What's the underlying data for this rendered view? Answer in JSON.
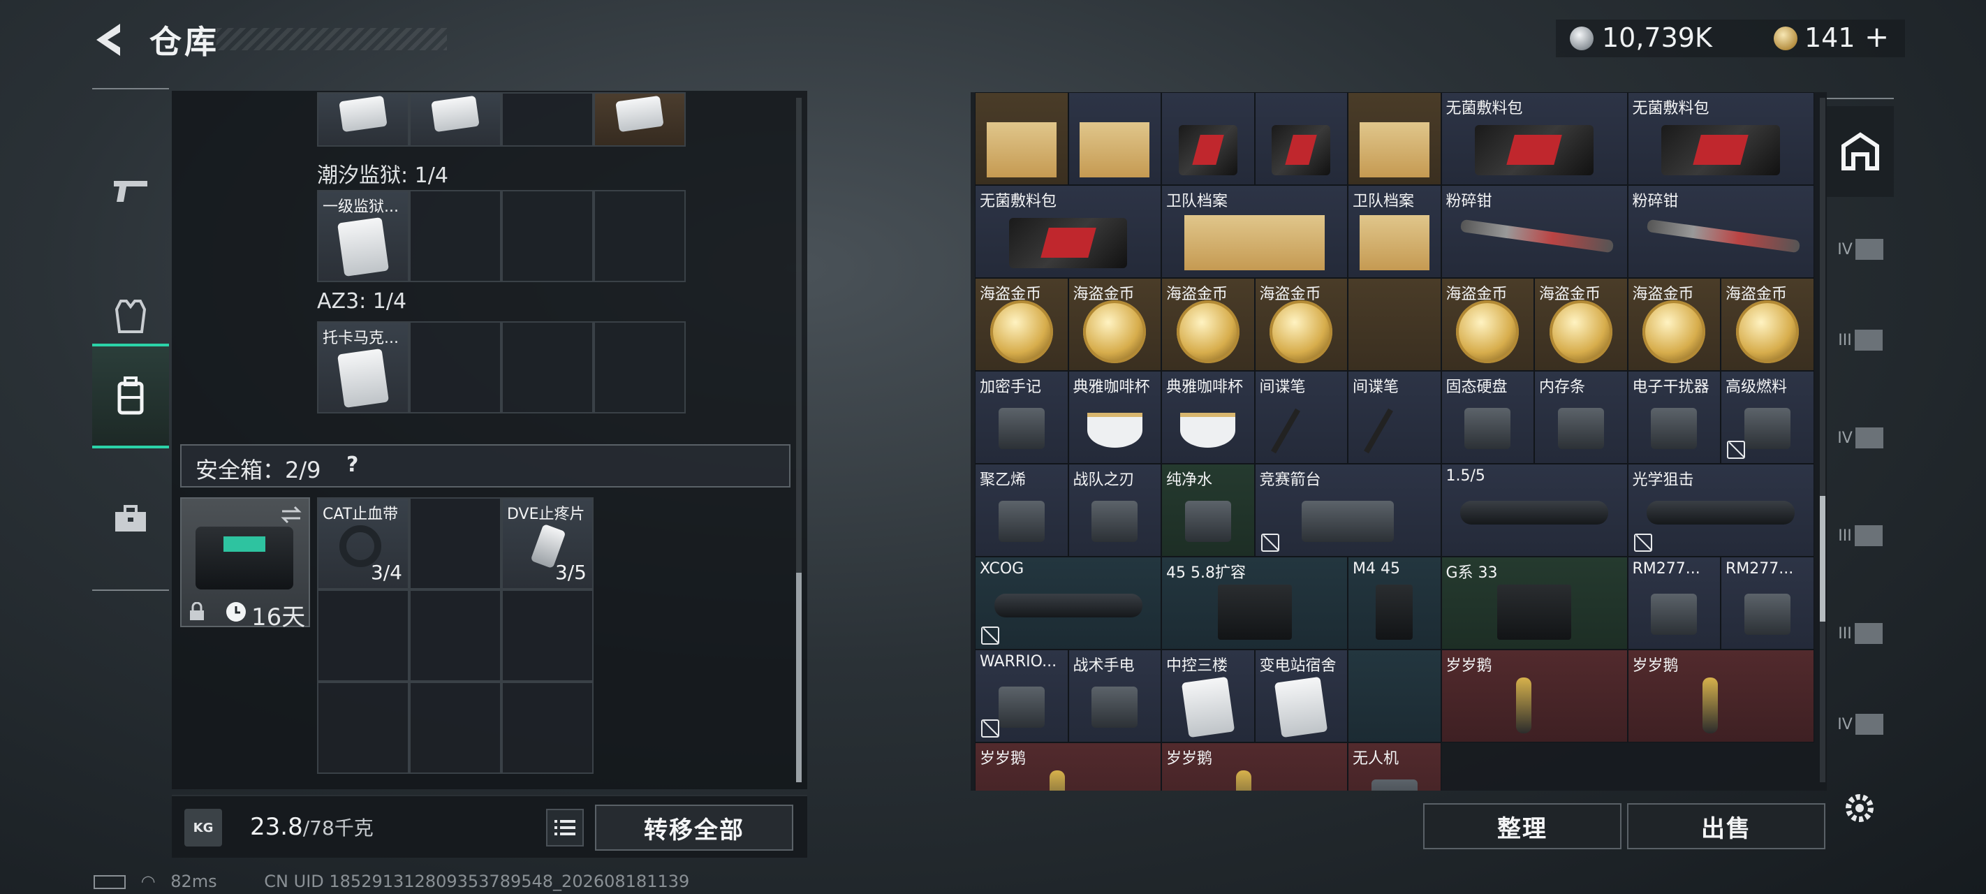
{
  "header": {
    "title": "仓库",
    "currency": {
      "silver": "10,739K",
      "gold": "141"
    },
    "add_label": "+"
  },
  "left_rail": [
    "rifle-tab",
    "armor-tab",
    "backpack-tab",
    "case-tab"
  ],
  "storage": {
    "sections": [
      {
        "label": "潮汐监狱: 1/4",
        "items": [
          {
            "name": "一级监狱..."
          }
        ]
      },
      {
        "label": "AZ3: 1/4",
        "items": [
          {
            "name": "托卡马克..."
          }
        ]
      }
    ],
    "safebox": {
      "label": "安全箱：2/9",
      "help": "?",
      "duration": "16天",
      "items": [
        {
          "name": "CAT止血带",
          "count": "3/4"
        },
        {
          "name": "DVE止疼片",
          "count": "3/5"
        }
      ]
    },
    "weight": {
      "current": "23.8",
      "unit": "/78千克"
    },
    "kg_label": "KG",
    "transfer_all": "转移全部"
  },
  "inventory": {
    "rows": [
      [
        {
          "name": "",
          "bg": "gold",
          "art": "file"
        },
        {
          "name": "",
          "bg": "blue",
          "art": "file"
        },
        {
          "name": "",
          "bg": "blue",
          "art": "pack"
        },
        {
          "name": "",
          "bg": "blue",
          "art": "pack"
        },
        {
          "name": "",
          "bg": "gold",
          "art": "file"
        }
      ],
      [
        {
          "name": "无菌敷料包",
          "bg": "blue",
          "art": "pack",
          "span": 2
        },
        {
          "name": "无菌敷料包",
          "bg": "blue",
          "art": "pack",
          "span": 2
        },
        {
          "name": "无菌敷料包",
          "bg": "blue",
          "art": "pack",
          "span": 2
        },
        {
          "name": "卫队档案",
          "bg": "blue",
          "art": "file",
          "span": 2
        },
        {
          "name": "卫队档案",
          "bg": "blue",
          "art": "file",
          "span": 1
        }
      ],
      [
        {
          "name": "粉碎钳",
          "bg": "blue",
          "art": "pliers",
          "span": 2
        },
        {
          "name": "粉碎钳",
          "bg": "blue",
          "art": "pliers",
          "span": 2
        },
        {
          "name": "海盗金币",
          "bg": "gold",
          "art": "coin"
        },
        {
          "name": "海盗金币",
          "bg": "gold",
          "art": "coin"
        },
        {
          "name": "海盗金币",
          "bg": "gold",
          "art": "coin"
        },
        {
          "name": "海盗金币",
          "bg": "gold",
          "art": "coin"
        },
        {
          "name": "",
          "bg": "gold",
          "art": "none"
        }
      ],
      [
        {
          "name": "海盗金币",
          "bg": "gold",
          "art": "coin"
        },
        {
          "name": "海盗金币",
          "bg": "gold",
          "art": "coin"
        },
        {
          "name": "海盗金币",
          "bg": "gold",
          "art": "coin"
        },
        {
          "name": "海盗金币",
          "bg": "gold",
          "art": "coin"
        },
        {
          "name": "加密手记",
          "bg": "blue",
          "art": "misc"
        },
        {
          "name": "典雅咖啡杯",
          "bg": "blue",
          "art": "cup"
        },
        {
          "name": "典雅咖啡杯",
          "bg": "blue",
          "art": "cup"
        },
        {
          "name": "间谍笔",
          "bg": "blue",
          "art": "pen"
        },
        {
          "name": "间谍笔",
          "bg": "blue",
          "art": "pen"
        }
      ],
      [
        {
          "name": "固态硬盘",
          "bg": "blue",
          "art": "misc"
        },
        {
          "name": "内存条",
          "bg": "blue",
          "art": "misc"
        },
        {
          "name": "电子干扰器",
          "bg": "blue",
          "art": "misc"
        },
        {
          "name": "高级燃料",
          "bg": "blue",
          "art": "misc",
          "nosell": true
        },
        {
          "name": "聚乙烯",
          "bg": "blue",
          "art": "misc"
        },
        {
          "name": "战队之刃",
          "bg": "blue",
          "art": "misc"
        },
        {
          "name": "纯净水",
          "bg": "green",
          "art": "misc"
        },
        {
          "name": "竞赛箭台",
          "bg": "blue",
          "art": "misc",
          "nosell": true,
          "span": 2
        }
      ],
      [
        {
          "name": "1.5/5",
          "bg": "blue",
          "art": "scope",
          "span": 2
        },
        {
          "name": "光学狙击",
          "bg": "blue",
          "art": "scope",
          "span": 2,
          "nosell": true
        },
        {
          "name": "XCOG",
          "bg": "teal",
          "art": "scope",
          "span": 2,
          "nosell": true
        },
        {
          "name": "45 5.8扩容",
          "bg": "teal",
          "art": "mag",
          "span": 2
        },
        {
          "name": "M4 45",
          "bg": "teal",
          "art": "mag",
          "span": 1
        }
      ],
      [
        {
          "name": "G系 33",
          "bg": "green",
          "art": "mag",
          "span": 2
        },
        {
          "name": "RM277...",
          "bg": "blue",
          "art": "misc"
        },
        {
          "name": "RM277...",
          "bg": "blue",
          "art": "misc"
        },
        {
          "name": "WARRIO...",
          "bg": "blue",
          "art": "misc",
          "nosell": true
        },
        {
          "name": "战术手电",
          "bg": "blue",
          "art": "misc"
        },
        {
          "name": "中控三楼",
          "bg": "blue",
          "art": "card"
        },
        {
          "name": "变电站宿舍",
          "bg": "blue",
          "art": "card"
        },
        {
          "name": "",
          "bg": "teal",
          "art": "none"
        }
      ],
      [
        {
          "name": "岁岁鹅",
          "bg": "red",
          "art": "bird",
          "span": 2
        },
        {
          "name": "岁岁鹅",
          "bg": "red",
          "art": "bird",
          "span": 2
        },
        {
          "name": "岁岁鹅",
          "bg": "red",
          "art": "bird",
          "span": 2
        },
        {
          "name": "岁岁鹅",
          "bg": "red",
          "art": "bird",
          "span": 2
        },
        {
          "name": "无人机",
          "bg": "red",
          "art": "misc",
          "span": 1
        }
      ]
    ],
    "organize": "整理",
    "sell": "出售"
  },
  "right_rail": [
    "safe-house-icon",
    "IV",
    "III",
    "IV",
    "III",
    "III",
    "IV"
  ],
  "status": {
    "ping": "82ms",
    "uid": "CN UID 185291312809353789548_202608181139"
  }
}
